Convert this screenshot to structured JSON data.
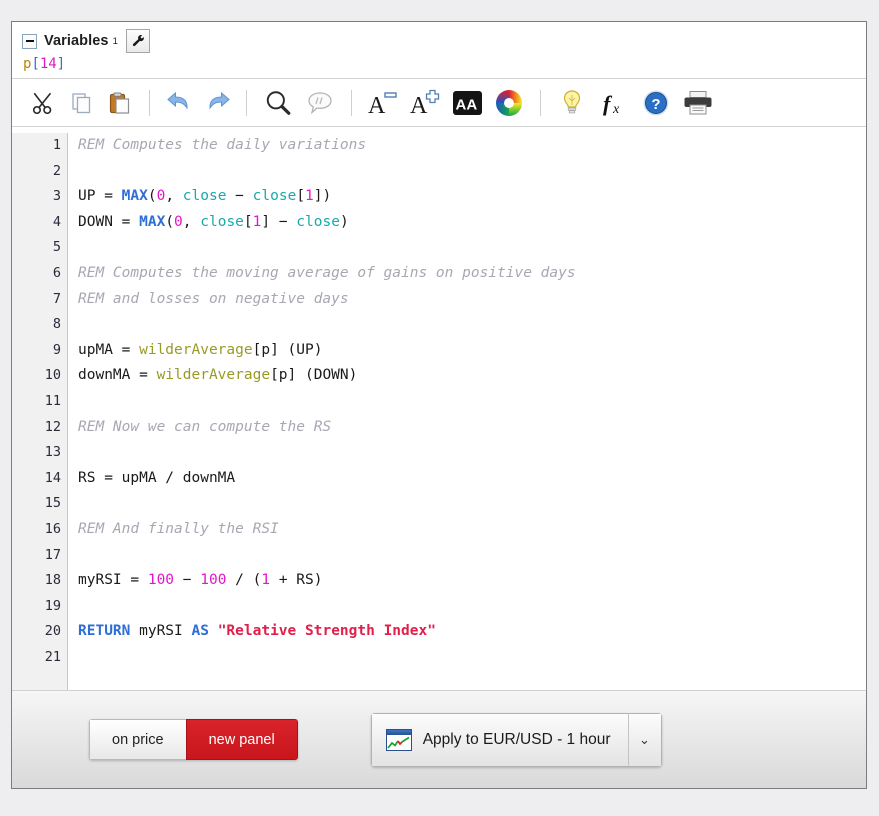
{
  "panel": {
    "header": {
      "collapse_icon": "minus-box-icon",
      "title": "Variables",
      "superscript": "1",
      "settings_icon": "wrench-icon",
      "variable_expr": {
        "name": "p",
        "open": "[",
        "value": "14",
        "close": "]"
      }
    },
    "toolbar": {
      "items": [
        {
          "name": "cut-icon",
          "glyph": "✂"
        },
        {
          "name": "copy-icon",
          "glyph": "⧉"
        },
        {
          "name": "paste-icon",
          "glyph": "📋"
        },
        {
          "name": "separator",
          "glyph": ""
        },
        {
          "name": "undo-icon",
          "glyph": "↶"
        },
        {
          "name": "redo-icon",
          "glyph": "↷"
        },
        {
          "name": "separator",
          "glyph": ""
        },
        {
          "name": "search-icon",
          "glyph": "🔍"
        },
        {
          "name": "comment-icon",
          "glyph": "💬"
        },
        {
          "name": "separator",
          "glyph": ""
        },
        {
          "name": "decrease-font-size-icon",
          "glyph": "A−"
        },
        {
          "name": "increase-font-size-icon",
          "glyph": "A+"
        },
        {
          "name": "font-style-icon",
          "glyph": "AA"
        },
        {
          "name": "color-picker-icon",
          "glyph": "◉"
        },
        {
          "name": "separator",
          "glyph": ""
        },
        {
          "name": "hint-lightbulb-icon",
          "glyph": "💡"
        },
        {
          "name": "insert-function-icon",
          "glyph": "fx"
        },
        {
          "name": "help-icon",
          "glyph": "?"
        },
        {
          "name": "print-icon",
          "glyph": "🖨"
        }
      ]
    },
    "editor": {
      "line_numbers": [
        "1",
        "2",
        "3",
        "4",
        "5",
        "6",
        "7",
        "8",
        "9",
        "10",
        "11",
        "12",
        "13",
        "14",
        "15",
        "16",
        "17",
        "18",
        "19",
        "20",
        "21"
      ],
      "lines": [
        [
          {
            "t": "REM Computes the daily variations",
            "c": "s-com"
          }
        ],
        [],
        [
          {
            "t": "UP = ",
            "c": "s-pln"
          },
          {
            "t": "MAX",
            "c": "s-fn"
          },
          {
            "t": "(",
            "c": "s-pln"
          },
          {
            "t": "0",
            "c": "s-num"
          },
          {
            "t": ", ",
            "c": "s-pln"
          },
          {
            "t": "close",
            "c": "s-var"
          },
          {
            "t": " − ",
            "c": "s-pln"
          },
          {
            "t": "close",
            "c": "s-var"
          },
          {
            "t": "[",
            "c": "s-pln"
          },
          {
            "t": "1",
            "c": "s-num"
          },
          {
            "t": "])",
            "c": "s-pln"
          }
        ],
        [
          {
            "t": "DOWN = ",
            "c": "s-pln"
          },
          {
            "t": "MAX",
            "c": "s-fn"
          },
          {
            "t": "(",
            "c": "s-pln"
          },
          {
            "t": "0",
            "c": "s-num"
          },
          {
            "t": ", ",
            "c": "s-pln"
          },
          {
            "t": "close",
            "c": "s-var"
          },
          {
            "t": "[",
            "c": "s-pln"
          },
          {
            "t": "1",
            "c": "s-num"
          },
          {
            "t": "] − ",
            "c": "s-pln"
          },
          {
            "t": "close",
            "c": "s-var"
          },
          {
            "t": ")",
            "c": "s-pln"
          }
        ],
        [],
        [
          {
            "t": "REM Computes the moving average of gains on positive days",
            "c": "s-com"
          }
        ],
        [
          {
            "t": "REM and losses on negative days",
            "c": "s-com"
          }
        ],
        [],
        [
          {
            "t": "upMA = ",
            "c": "s-pln"
          },
          {
            "t": "wilderAverage",
            "c": "s-usr"
          },
          {
            "t": "[p] (UP)",
            "c": "s-pln"
          }
        ],
        [
          {
            "t": "downMA = ",
            "c": "s-pln"
          },
          {
            "t": "wilderAverage",
            "c": "s-usr"
          },
          {
            "t": "[p] (DOWN)",
            "c": "s-pln"
          }
        ],
        [],
        [
          {
            "t": "REM Now we can compute the RS",
            "c": "s-com"
          }
        ],
        [],
        [
          {
            "t": "RS = upMA / downMA",
            "c": "s-pln"
          }
        ],
        [],
        [
          {
            "t": "REM And finally the RSI",
            "c": "s-com"
          }
        ],
        [],
        [
          {
            "t": "myRSI = ",
            "c": "s-pln"
          },
          {
            "t": "100",
            "c": "s-num"
          },
          {
            "t": " − ",
            "c": "s-pln"
          },
          {
            "t": "100",
            "c": "s-num"
          },
          {
            "t": " / (",
            "c": "s-pln"
          },
          {
            "t": "1",
            "c": "s-num"
          },
          {
            "t": " + RS)",
            "c": "s-pln"
          }
        ],
        [],
        [
          {
            "t": "RETURN",
            "c": "s-kw"
          },
          {
            "t": " myRSI ",
            "c": "s-pln"
          },
          {
            "t": "AS",
            "c": "s-kw"
          },
          {
            "t": " ",
            "c": "s-pln"
          },
          {
            "t": "\"Relative Strength Index\"",
            "c": "s-str"
          }
        ],
        []
      ]
    },
    "footer": {
      "display_toggle": {
        "on_price_label": "on price",
        "new_panel_label": "new panel",
        "selected": "new panel"
      },
      "apply": {
        "icon": "chart-window-icon",
        "label": "Apply to EUR/USD - 1 hour",
        "dropdown_icon": "chevron-down-icon",
        "dropdown_glyph": "⌄"
      }
    }
  },
  "colors": {
    "accent_red": "#c9151c",
    "keyword_blue": "#2d6fd6",
    "number_magenta": "#e018c8",
    "variable_teal": "#1aa8b0",
    "comment_gray": "#a8a8b4",
    "string_red": "#e0204a",
    "user_func_olive": "#9a9a25"
  }
}
